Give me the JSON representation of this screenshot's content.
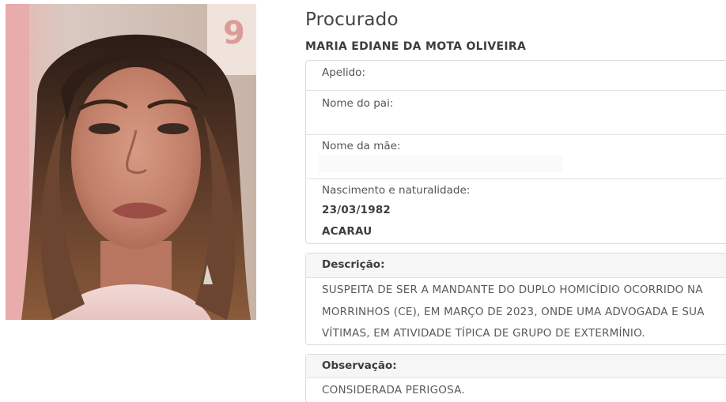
{
  "title": "Procurado",
  "name": "MARIA EDIANE DA MOTA OLIVEIRA",
  "fields": {
    "apelido_label": "Apelido:",
    "pai_label": "Nome do pai:",
    "mae_label": "Nome da mãe:",
    "nascimento_label": "Nascimento e naturalidade:",
    "nascimento_date": "23/03/1982",
    "naturalidade": "ACARAU"
  },
  "descricao": {
    "label": "Descrição:",
    "lines": [
      "SUSPEITA DE SER A MANDANTE DO DUPLO HOMICÍDIO OCORRIDO NA",
      "MORRINHOS (CE), EM MARÇO DE 2023, ONDE UMA ADVOGADA E SUA",
      "VÍTIMAS, EM ATIVIDADE TÍPICA DE GRUPO DE EXTERMÍNIO."
    ]
  },
  "observacao": {
    "label": "Observação:",
    "text": "CONSIDERADA PERIGOSA."
  },
  "colors": {
    "card_border": "#dcdcdc",
    "header_bg": "#f6f6f6",
    "text": "#333333"
  }
}
